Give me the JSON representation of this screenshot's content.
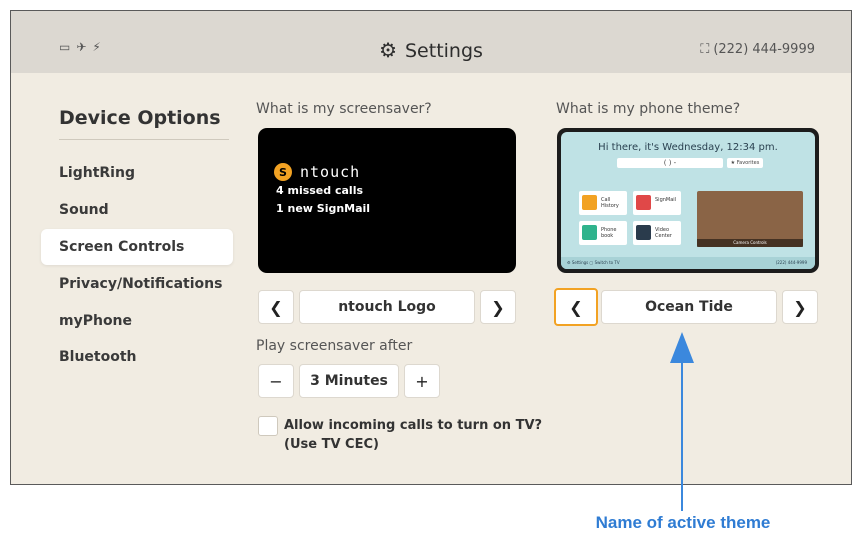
{
  "header": {
    "title": "Settings",
    "phone": "(222) 444-9999",
    "status_icons": [
      "display-icon",
      "camera-off-icon",
      "microphone-off-icon"
    ]
  },
  "sidebar": {
    "title": "Device Options",
    "items": [
      {
        "label": "LightRing"
      },
      {
        "label": "Sound"
      },
      {
        "label": "Screen Controls",
        "active": true
      },
      {
        "label": "Privacy/Notifications"
      },
      {
        "label": "myPhone"
      },
      {
        "label": "Bluetooth"
      }
    ]
  },
  "screensaver": {
    "question": "What is my screensaver?",
    "preview_brand": "ntouch",
    "preview_lines": [
      "4 missed calls",
      "1 new SignMail"
    ],
    "selected": "ntouch Logo",
    "prev_glyph": "❮",
    "next_glyph": "❯"
  },
  "play_after": {
    "label": "Play screensaver after",
    "value": "3 Minutes",
    "minus": "−",
    "plus": "+"
  },
  "cec": {
    "label_line1": "Allow incoming calls to turn on TV?",
    "label_line2": "(Use TV CEC)"
  },
  "theme": {
    "question": "What is my phone theme?",
    "selected": "Ocean Tide",
    "prev_glyph": "❮",
    "next_glyph": "❯",
    "preview": {
      "greeting": "Hi there, it's Wednesday, 12:34 pm.",
      "search": "(  )  -",
      "favorites": "★ Favorites",
      "tiles": [
        "Call History",
        "SignMail",
        "Phone book",
        "Video Center"
      ],
      "video_caption": "Camera Controls",
      "bottom_left": "⚙ Settings  ▢ Switch to TV",
      "bottom_right": "(222) 444-9999"
    }
  },
  "annotation": {
    "text": "Name of active theme"
  },
  "colors": {
    "accent": "#f2a223",
    "annotation": "#2f7cd3",
    "background": "#f1ece2"
  }
}
